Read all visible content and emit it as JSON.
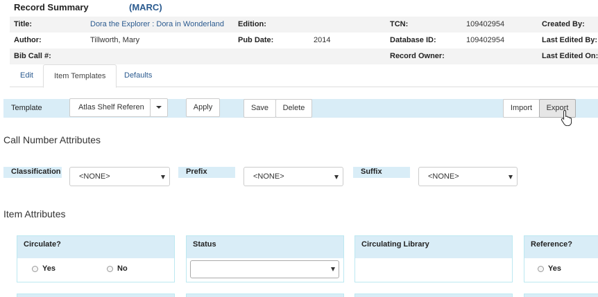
{
  "summary": {
    "title": "Record Summary",
    "marc": "(MARC)",
    "rows": {
      "title_label": "Title:",
      "title_value": "Dora the Explorer : Dora in Wonderland",
      "edition_label": "Edition:",
      "tcn_label": "TCN:",
      "tcn_value": "109402954",
      "created_by_label": "Created By:",
      "author_label": "Author:",
      "author_value": "Tillworth, Mary",
      "pub_date_label": "Pub Date:",
      "pub_date_value": "2014",
      "database_id_label": "Database ID:",
      "database_id_value": "109402954",
      "last_edited_by_label": "Last Edited By:",
      "bib_call_label": "Bib Call #:",
      "record_owner_label": "Record Owner:",
      "last_edited_on_label": "Last Edited On:"
    }
  },
  "tabs": [
    {
      "label": "Edit",
      "active": false
    },
    {
      "label": "Item Templates",
      "active": true
    },
    {
      "label": "Defaults",
      "active": false
    }
  ],
  "template_bar": {
    "label": "Template",
    "selected": "Atlas Shelf Referen",
    "apply": "Apply",
    "save": "Save",
    "delete": "Delete",
    "import": "Import",
    "export": "Export"
  },
  "call_number": {
    "heading": "Call Number Attributes",
    "classification_label": "Classification",
    "classification_value": "<NONE>",
    "prefix_label": "Prefix",
    "prefix_value": "<NONE>",
    "suffix_label": "Suffix",
    "suffix_value": "<NONE>"
  },
  "item_attributes": {
    "heading": "Item Attributes",
    "circulate_label": "Circulate?",
    "circulate_yes": "Yes",
    "circulate_no": "No",
    "status_label": "Status",
    "circ_lib_label": "Circulating Library",
    "reference_label": "Reference?",
    "reference_yes": "Yes"
  },
  "colors": {
    "accent_bg": "#d9edf7",
    "link": "#2a5a8f",
    "border": "#bce8f1"
  }
}
